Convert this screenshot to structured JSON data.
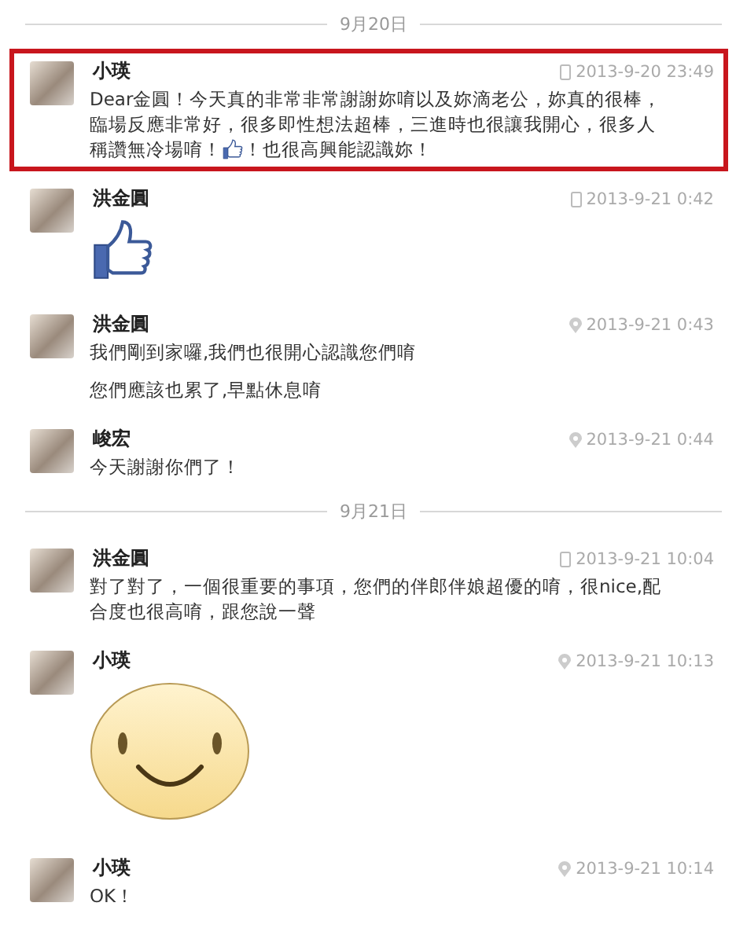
{
  "feed": [
    {
      "kind": "divider",
      "label": "9月20日"
    },
    {
      "kind": "message",
      "name": "小瑛",
      "time": "2013-9-20 23:49",
      "time_icon": {
        "kind": "device"
      },
      "highlighted": true,
      "body": [
        {
          "kind": "text-with-thumb",
          "before": "Dear金圓！今天真的非常非常謝謝妳唷以及妳滴老公，妳真的很棒，臨場反應非常好，很多即性想法超棒，三進時也很讓我開心，很多人稱讚無冷場唷！",
          "after": "！也很高興能認識妳！"
        }
      ]
    },
    {
      "kind": "message",
      "name": "洪金圓",
      "time": "2013-9-21 0:42",
      "time_icon": {
        "kind": "device"
      },
      "highlighted": false,
      "body": [
        {
          "kind": "thumb-sticker"
        }
      ]
    },
    {
      "kind": "message",
      "name": "洪金圓",
      "time": "2013-9-21 0:43",
      "time_icon": {
        "kind": "location"
      },
      "highlighted": false,
      "body": [
        {
          "kind": "text",
          "text": "我們剛到家囉,我們也很開心認識您們唷"
        },
        {
          "kind": "text",
          "text": "您們應該也累了,早點休息唷"
        }
      ]
    },
    {
      "kind": "message",
      "name": "峻宏",
      "time": "2013-9-21 0:44",
      "time_icon": {
        "kind": "location"
      },
      "highlighted": false,
      "body": [
        {
          "kind": "text",
          "text": "今天謝謝你們了！"
        }
      ]
    },
    {
      "kind": "divider",
      "label": "9月21日"
    },
    {
      "kind": "message",
      "name": "洪金圓",
      "time": "2013-9-21 10:04",
      "time_icon": {
        "kind": "device"
      },
      "highlighted": false,
      "body": [
        {
          "kind": "text",
          "text": "對了對了，一個很重要的事項，您們的伴郎伴娘超優的唷，很nice,配合度也很高唷，跟您說一聲"
        }
      ]
    },
    {
      "kind": "message",
      "name": "小瑛",
      "time": "2013-9-21 10:13",
      "time_icon": {
        "kind": "location"
      },
      "highlighted": false,
      "body": [
        {
          "kind": "smiley-sticker"
        }
      ]
    },
    {
      "kind": "message",
      "name": "小瑛",
      "time": "2013-9-21 10:14",
      "time_icon": {
        "kind": "location"
      },
      "highlighted": false,
      "body": [
        {
          "kind": "text",
          "text": "OK！"
        }
      ]
    }
  ]
}
